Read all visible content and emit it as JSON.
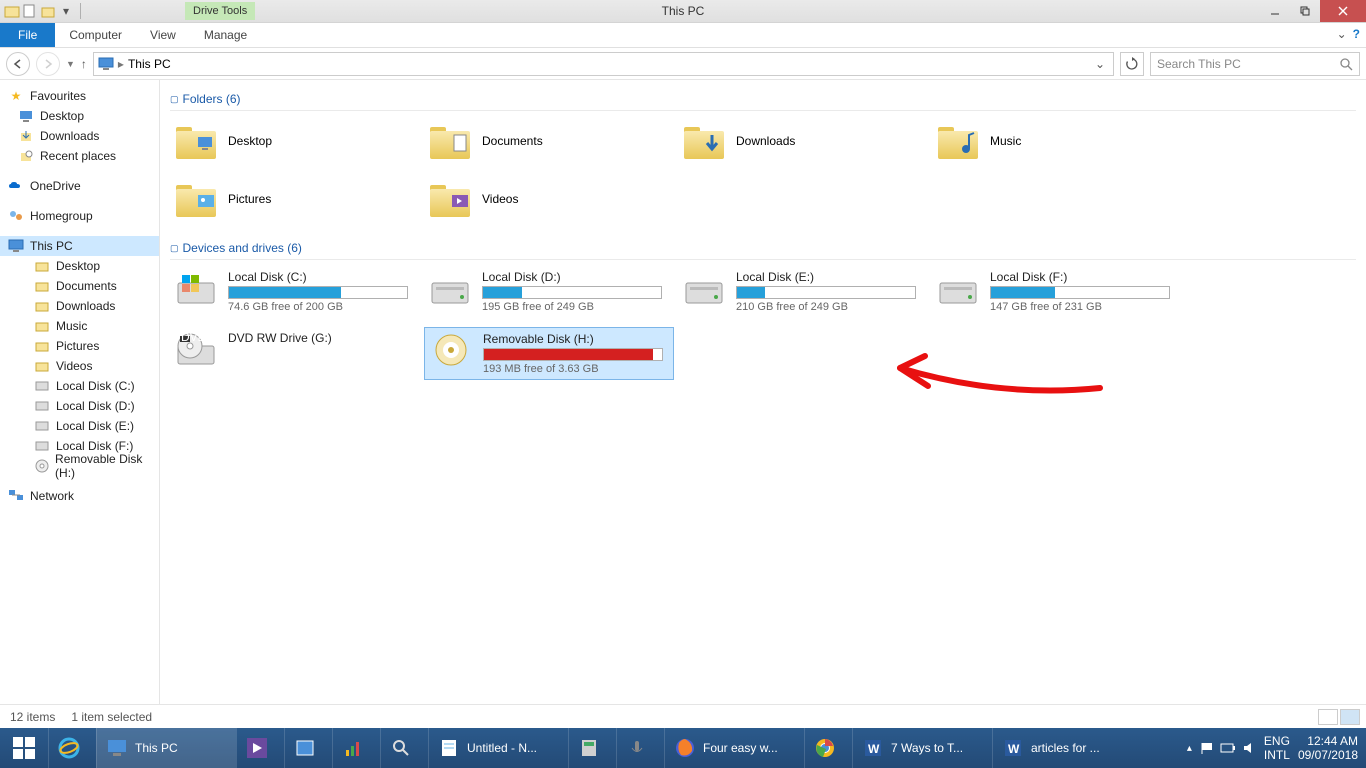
{
  "window": {
    "title": "This PC",
    "drive_tools": "Drive Tools"
  },
  "ribbon": {
    "file": "File",
    "tabs": [
      "Computer",
      "View",
      "Manage"
    ]
  },
  "nav": {
    "breadcrumb": "This PC",
    "search_placeholder": "Search This PC"
  },
  "sidebar": {
    "favourites": {
      "label": "Favourites",
      "items": [
        "Desktop",
        "Downloads",
        "Recent places"
      ]
    },
    "onedrive": "OneDrive",
    "homegroup": "Homegroup",
    "this_pc": {
      "label": "This PC",
      "items": [
        "Desktop",
        "Documents",
        "Downloads",
        "Music",
        "Pictures",
        "Videos",
        "Local Disk (C:)",
        "Local Disk (D:)",
        "Local Disk (E:)",
        "Local Disk (F:)",
        "Removable Disk (H:)"
      ]
    },
    "network": "Network"
  },
  "sections": {
    "folders": "Folders (6)",
    "drives": "Devices and drives (6)"
  },
  "folders": [
    {
      "name": "Desktop"
    },
    {
      "name": "Documents"
    },
    {
      "name": "Downloads"
    },
    {
      "name": "Music"
    },
    {
      "name": "Pictures"
    },
    {
      "name": "Videos"
    }
  ],
  "drives": [
    {
      "name": "Local Disk (C:)",
      "free": "74.6 GB free of 200 GB",
      "pct": 63,
      "color": "blue"
    },
    {
      "name": "Local Disk (D:)",
      "free": "195 GB free of 249 GB",
      "pct": 22,
      "color": "blue"
    },
    {
      "name": "Local Disk (E:)",
      "free": "210 GB free of 249 GB",
      "pct": 16,
      "color": "blue"
    },
    {
      "name": "Local Disk (F:)",
      "free": "147 GB free of 231 GB",
      "pct": 36,
      "color": "blue"
    },
    {
      "name": "DVD RW Drive (G:)",
      "free": "",
      "pct": null,
      "color": "none",
      "type": "dvd"
    },
    {
      "name": "Removable Disk (H:)",
      "free": "193 MB free of 3.63 GB",
      "pct": 95,
      "color": "red",
      "selected": true
    }
  ],
  "status": {
    "count": "12 items",
    "selected": "1 item selected"
  },
  "taskbar": {
    "items": [
      {
        "label": "This PC",
        "wide": true,
        "active": true
      },
      {
        "label": "",
        "icon": "media"
      },
      {
        "label": "",
        "icon": "window"
      },
      {
        "label": "",
        "icon": "chart"
      },
      {
        "label": "",
        "icon": "search"
      },
      {
        "label": "Untitled - N...",
        "wide": true,
        "icon": "notepad"
      },
      {
        "label": "",
        "icon": "calc"
      },
      {
        "label": "",
        "icon": "mic"
      },
      {
        "label": "Four easy w...",
        "wide": true,
        "icon": "firefox"
      },
      {
        "label": "",
        "icon": "chrome"
      },
      {
        "label": "7 Ways to T...",
        "wide": true,
        "icon": "word"
      },
      {
        "label": "articles for ...",
        "wide": true,
        "icon": "word"
      }
    ],
    "lang1": "ENG",
    "lang2": "INTL",
    "time": "12:44 AM",
    "date": "09/07/2018"
  }
}
